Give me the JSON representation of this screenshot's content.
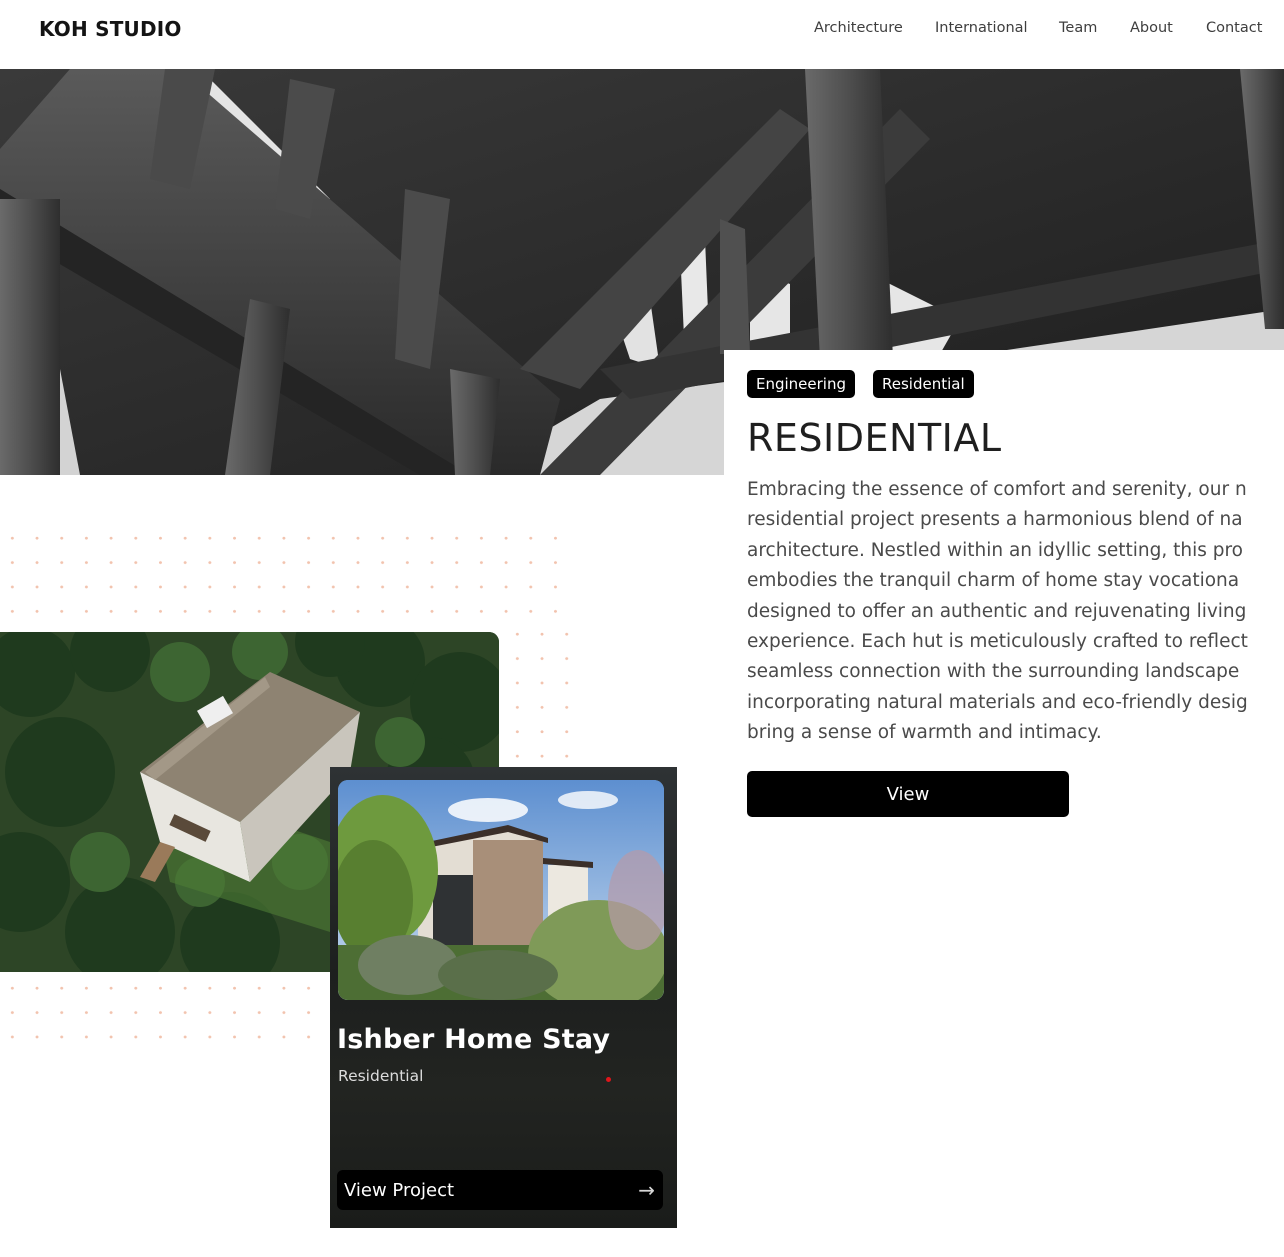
{
  "header": {
    "logo": "KOH STUDIO",
    "nav": [
      "Architecture",
      "International",
      "Team",
      "About",
      "Contact"
    ]
  },
  "hero": {
    "image": "concrete-structure-photo"
  },
  "project_info": {
    "tags": [
      "Engineering",
      "Residential"
    ],
    "title": "RESIDENTIAL",
    "description_lines": [
      "Embracing the essence of comfort and serenity, our n",
      "residential project presents a harmonious blend of na",
      "architecture. Nestled within an idyllic setting, this pro",
      "embodies the tranquil charm of home stay vocationa",
      "designed to offer an authentic and rejuvenating living",
      "experience. Each hut is meticulously crafted to reflect",
      "seamless connection with the surrounding landscape",
      "incorporating natural materials and eco-friendly desig",
      "bring a sense of warmth and intimacy."
    ],
    "view_label": "View"
  },
  "card": {
    "title": "Ishber Home Stay",
    "category": "Residential",
    "button_label": "View Project",
    "button_icon": "arrow-right-icon"
  },
  "colors": {
    "accent": "#000000",
    "dots": "#f2c3ae",
    "marker": "#e0161b"
  }
}
